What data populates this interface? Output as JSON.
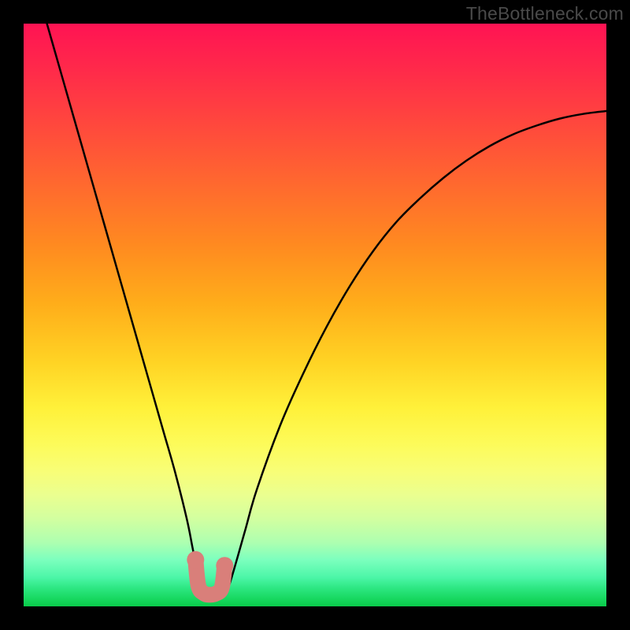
{
  "watermark": "TheBottleneck.com",
  "chart_data": {
    "type": "line",
    "title": "",
    "xlabel": "",
    "ylabel": "",
    "xlim": [
      0,
      100
    ],
    "ylim": [
      0,
      100
    ],
    "series": [
      {
        "name": "curve",
        "x": [
          4,
          6,
          8,
          10,
          12,
          14,
          16,
          18,
          20,
          22,
          24,
          26,
          28,
          29,
          30,
          31,
          32,
          33,
          34,
          35,
          36,
          38,
          40,
          44,
          48,
          52,
          56,
          60,
          64,
          68,
          72,
          76,
          80,
          84,
          88,
          92,
          96,
          100
        ],
        "y": [
          100,
          93,
          86,
          79,
          72,
          65,
          58,
          51,
          44,
          37,
          30,
          23,
          15,
          10,
          5,
          3,
          2,
          2,
          2,
          3,
          6,
          13,
          20,
          31,
          40,
          48,
          55,
          61,
          66,
          70,
          73.5,
          76.5,
          79,
          81,
          82.5,
          83.7,
          84.5,
          85
        ]
      }
    ],
    "highlight_segment": {
      "name": "flat-region",
      "x": [
        29.5,
        30,
        31,
        32,
        33,
        34,
        34.5
      ],
      "y": [
        8,
        3.5,
        2.2,
        2,
        2.2,
        3.2,
        7
      ]
    },
    "gradient_stops_pct": [
      0,
      8,
      18,
      28,
      38,
      48,
      58,
      66,
      72,
      77,
      81,
      85,
      89,
      92,
      95,
      97,
      99,
      100
    ]
  }
}
